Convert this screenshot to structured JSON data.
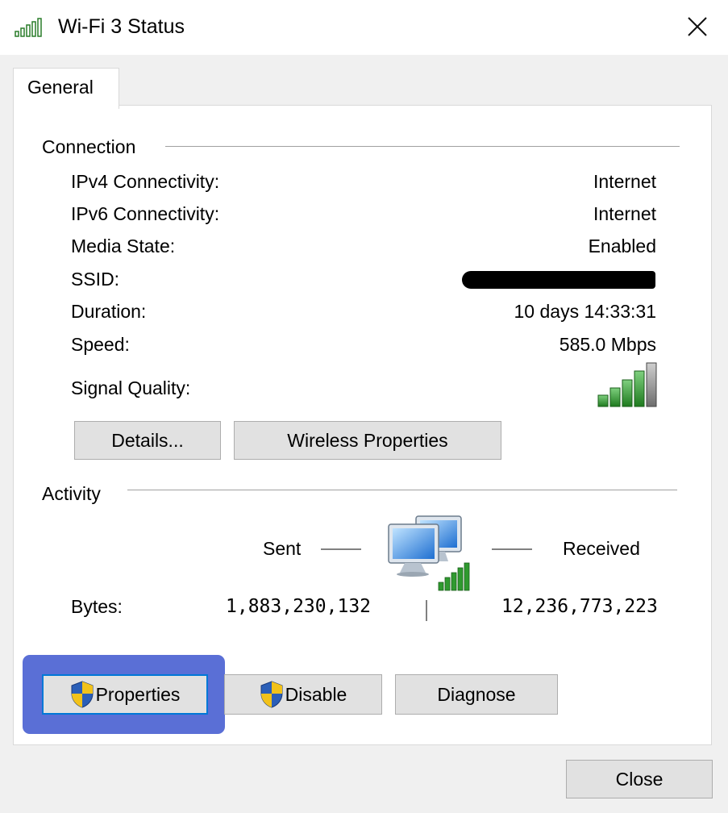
{
  "window": {
    "title": "Wi-Fi 3 Status",
    "icon": "wifi-signal-icon",
    "close_icon": "close-icon"
  },
  "tabs": [
    {
      "label": "General",
      "selected": true
    }
  ],
  "connection": {
    "heading": "Connection",
    "rows": [
      {
        "label": "IPv4 Connectivity:",
        "value": "Internet"
      },
      {
        "label": "IPv6 Connectivity:",
        "value": "Internet"
      },
      {
        "label": "Media State:",
        "value": "Enabled"
      },
      {
        "label": "SSID:",
        "value": ""
      },
      {
        "label": "Duration:",
        "value": "10 days 14:33:31"
      },
      {
        "label": "Speed:",
        "value": "585.0 Mbps"
      }
    ],
    "ssid_redacted": true,
    "signal_quality": {
      "label": "Signal Quality:",
      "bars_filled": 4,
      "bars_total": 5,
      "icon": "signal-bars-icon"
    },
    "buttons": {
      "details": "Details...",
      "wireless_properties": "Wireless Properties"
    }
  },
  "activity": {
    "heading": "Activity",
    "sent_label": "Sent",
    "received_label": "Received",
    "bytes_label": "Bytes:",
    "bytes_sent": "1,883,230,132",
    "bytes_received": "12,236,773,223",
    "icon": "network-computers-icon"
  },
  "footer_buttons": {
    "properties": "Properties",
    "disable": "Disable",
    "diagnose": "Diagnose",
    "shield_icon": "uac-shield-icon"
  },
  "close_button": "Close",
  "colors": {
    "highlight": "#5a6fd6",
    "signal_green": "#3a9a3a",
    "focus_border": "#0078d7"
  }
}
